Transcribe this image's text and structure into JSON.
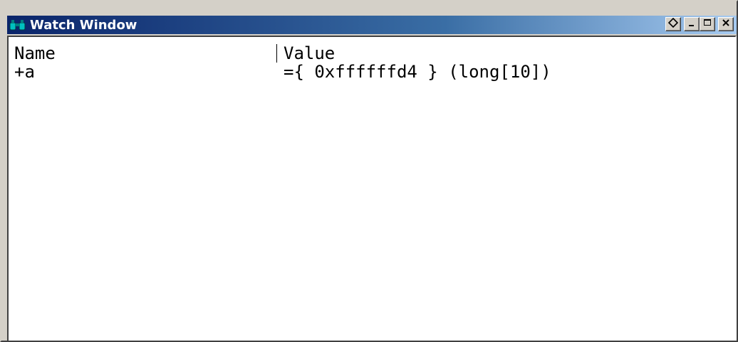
{
  "window": {
    "title": "Watch Window"
  },
  "icons": {
    "app": "binoculars-icon",
    "pin": "pin-diamond-icon",
    "minimize": "minimize-icon",
    "maximize": "maximize-icon",
    "close": "close-icon"
  },
  "columns": {
    "name": "Name",
    "value": "Value"
  },
  "rows": [
    {
      "name": "+a",
      "value": "={ 0xffffffd4 } (long[10])"
    }
  ]
}
